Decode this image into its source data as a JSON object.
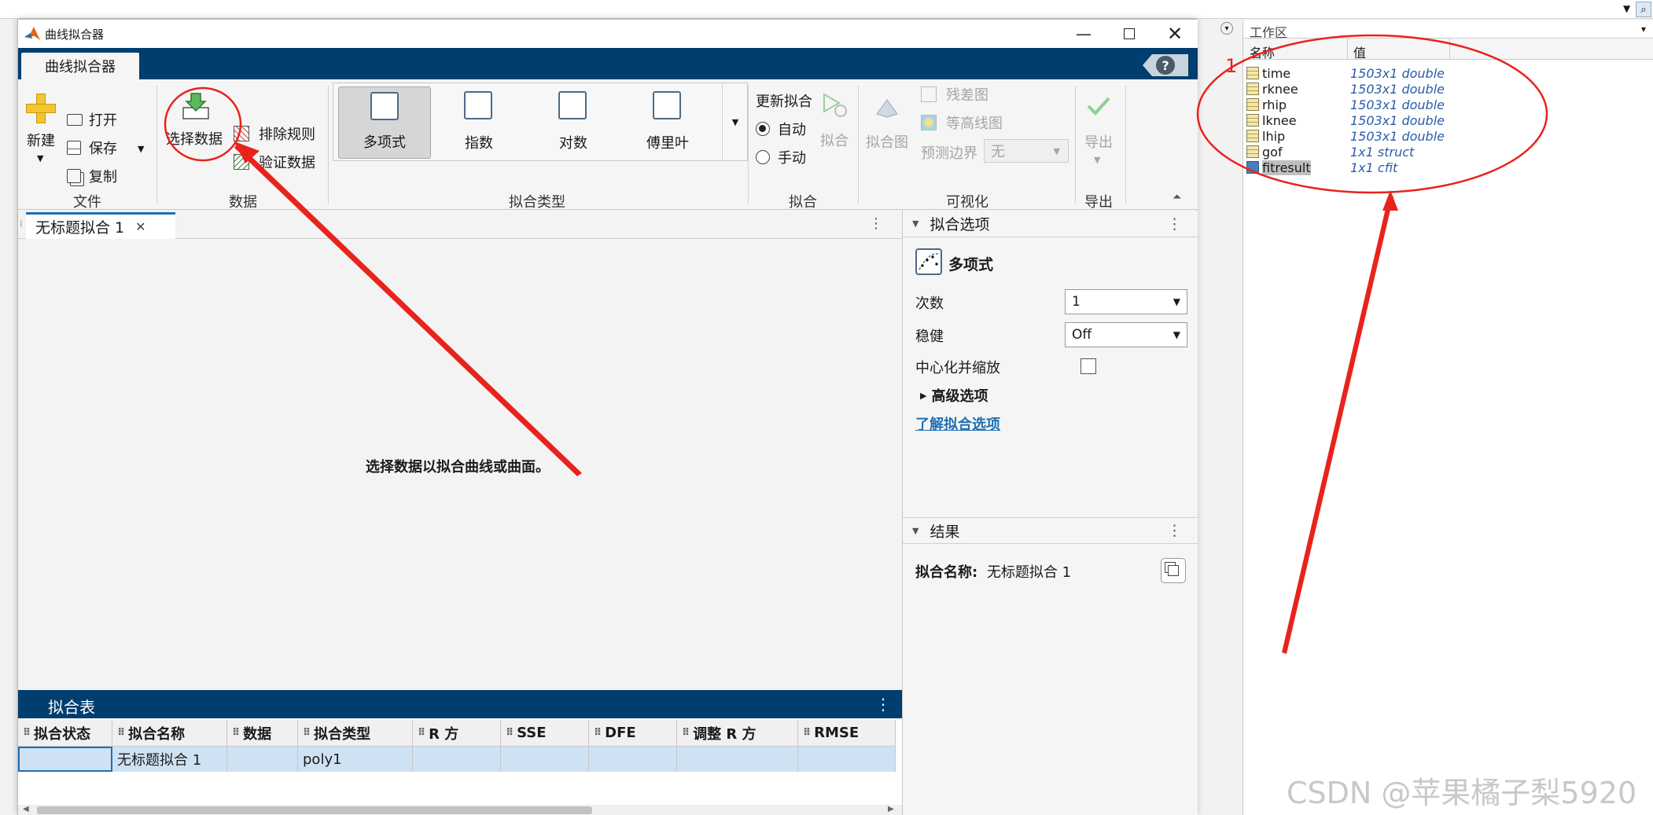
{
  "window": {
    "title": "曲线拟合器",
    "app_tab": "曲线拟合器",
    "help": "?"
  },
  "ribbon": {
    "file": {
      "new": "新建",
      "open": "打开",
      "save": "保存",
      "copy": "复制",
      "group": "文件"
    },
    "data": {
      "select": "选择数据",
      "exclude": "排除规则",
      "validate": "验证数据",
      "group": "数据"
    },
    "fit_types": {
      "items": [
        "多项式",
        "指数",
        "对数",
        "傅里叶"
      ],
      "selected": "多项式",
      "group": "拟合类型"
    },
    "fit": {
      "auto_update": "更新拟合",
      "auto": "自动",
      "manual": "手动",
      "fit_button": "拟合",
      "group": "拟合",
      "selected_mode": "自动"
    },
    "visual": {
      "fit_plot": "拟合图",
      "residual": "残差图",
      "contour": "等高线图",
      "pred_bounds": "预测边界",
      "pred_value": "无",
      "group": "可视化"
    },
    "export": {
      "label": "导出",
      "group": "导出"
    }
  },
  "document": {
    "tab": "无标题拟合 1",
    "prompt": "选择数据以拟合曲线或曲面。"
  },
  "fit_options": {
    "header": "拟合选项",
    "type": "多项式",
    "degree_label": "次数",
    "degree_value": "1",
    "robust_label": "稳健",
    "robust_value": "Off",
    "center_label": "中心化并缩放",
    "advanced": "高级选项",
    "learn_link": "了解拟合选项"
  },
  "results": {
    "header": "结果",
    "fit_name_label": "拟合名称:",
    "fit_name_value": "无标题拟合 1"
  },
  "fit_table": {
    "title": "拟合表",
    "columns": [
      "拟合状态",
      "拟合名称",
      "数据",
      "拟合类型",
      "R 方",
      "SSE",
      "DFE",
      "调整 R 方",
      "RMSE"
    ],
    "rows": [
      [
        "",
        "无标题拟合 1",
        "",
        "poly1",
        "",
        "",
        "",
        "",
        ""
      ]
    ]
  },
  "workspace": {
    "title": "工作区",
    "col_name": "名称",
    "col_value": "值",
    "vars": [
      {
        "name": "time",
        "value": "1503x1 double"
      },
      {
        "name": "rknee",
        "value": "1503x1 double"
      },
      {
        "name": "rhip",
        "value": "1503x1 double"
      },
      {
        "name": "lknee",
        "value": "1503x1 double"
      },
      {
        "name": "lhip",
        "value": "1503x1 double"
      },
      {
        "name": "gof",
        "value": "1x1 struct"
      },
      {
        "name": "fitresult",
        "value": "1x1 cfit"
      }
    ]
  },
  "annotation": {
    "marker": "1"
  },
  "watermark": "CSDN @苹果橘子梨5920",
  "colors": {
    "titlebar_blue": "#003e6f",
    "accent": "#1f6fb5",
    "annotation_red": "#e8231c"
  }
}
